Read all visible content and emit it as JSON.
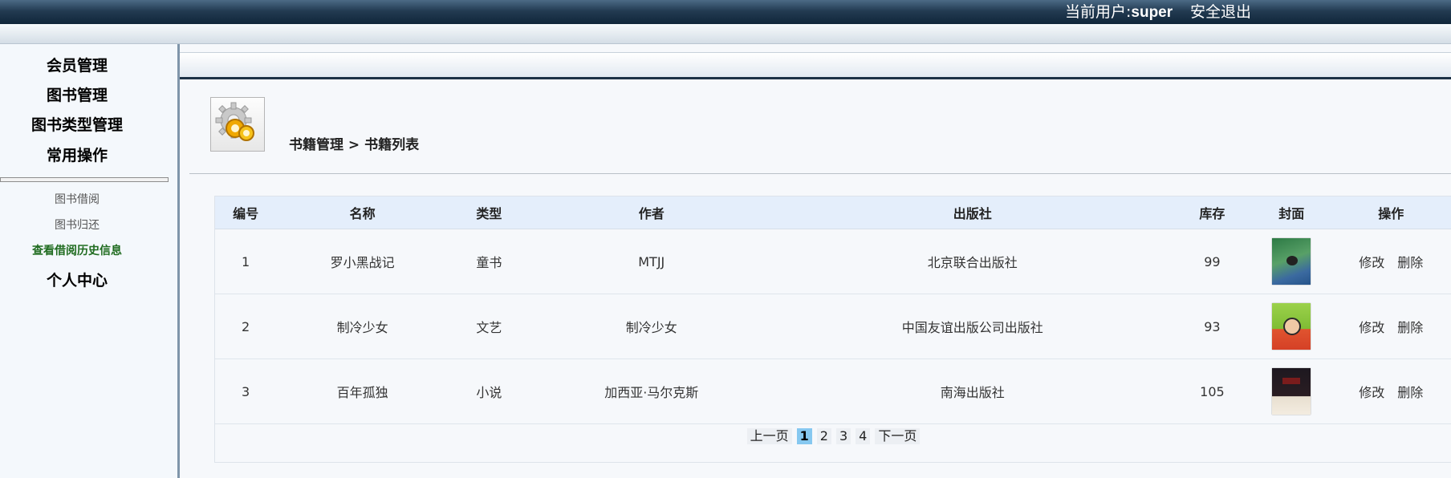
{
  "header": {
    "user_label": "当前用户:",
    "username": "super",
    "logout": "安全退出"
  },
  "sidebar": {
    "menus": [
      "会员管理",
      "图书管理",
      "图书类型管理",
      "常用操作"
    ],
    "subitems": [
      {
        "label": "图书借阅",
        "active": false
      },
      {
        "label": "图书归还",
        "active": false
      },
      {
        "label": "查看借阅历史信息",
        "active": true
      }
    ],
    "profile": "个人中心"
  },
  "main": {
    "breadcrumb": "书籍管理 > 书籍列表",
    "table": {
      "columns": [
        "编号",
        "名称",
        "类型",
        "作者",
        "出版社",
        "库存",
        "封面",
        "操作"
      ],
      "rows": [
        {
          "id": "1",
          "name": "罗小黑战记",
          "type": "童书",
          "author": "MTJJ",
          "publisher": "北京联合出版社",
          "stock": "99",
          "cover": "cover-image-green"
        },
        {
          "id": "2",
          "name": "制冷少女",
          "type": "文艺",
          "author": "制冷少女",
          "publisher": "中国友谊出版公司出版社",
          "stock": "93",
          "cover": "cover-image-lime"
        },
        {
          "id": "3",
          "name": "百年孤独",
          "type": "小说",
          "author": "加西亚·马尔克斯",
          "publisher": "南海出版社",
          "stock": "105",
          "cover": "cover-image-dark"
        }
      ],
      "actions": {
        "edit": "修改",
        "delete": "删除"
      }
    },
    "pager": {
      "prev": "上一页",
      "pages": [
        "1",
        "2",
        "3",
        "4"
      ],
      "current": "1",
      "next": "下一页"
    }
  },
  "colors": {
    "topbar": "#1a3249",
    "active_link": "#1f6b1f",
    "pager_current": "#86c8f0",
    "table_header": "#e4eefb"
  }
}
